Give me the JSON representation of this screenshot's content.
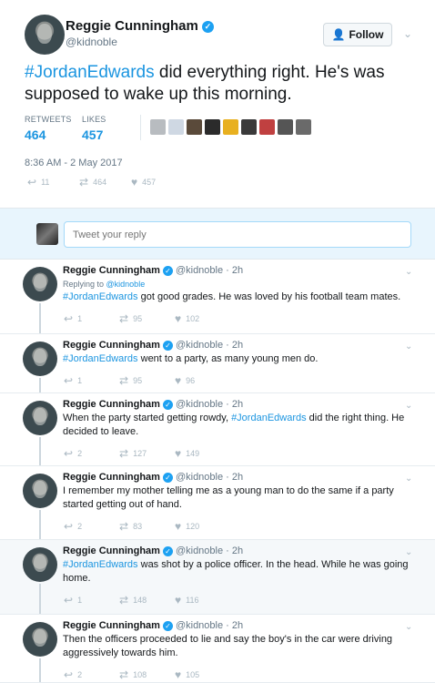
{
  "main": {
    "author_name": "Reggie Cunningham",
    "author_handle": "@kidnoble",
    "follow_label": "Follow",
    "text_hashtag": "#JordanEdwards",
    "text_rest": " did everything right. He's was supposed to wake up this morning.",
    "retweets_label": "RETWEETS",
    "retweets": "464",
    "likes_label": "LIKES",
    "likes": "457",
    "timestamp": "8:36 AM - 2 May 2017",
    "reply_count": "11",
    "retweet_count": "464",
    "like_count": "457"
  },
  "reply_box": {
    "placeholder": "Tweet your reply"
  },
  "replies": [
    {
      "name": "Reggie Cunningham",
      "handle": "@kidnoble · 2h",
      "replying_prefix": "Replying to ",
      "replying_to": "@kidnoble",
      "hashtag": "#JordanEdwards",
      "text": " got good grades. He was loved by his football team mates.",
      "replies": "1",
      "retweets": "95",
      "likes": "102"
    },
    {
      "name": "Reggie Cunningham",
      "handle": "@kidnoble · 2h",
      "hashtag": "#JordanEdwards",
      "text": " went to a party, as many young men do.",
      "replies": "1",
      "retweets": "95",
      "likes": "96"
    },
    {
      "name": "Reggie Cunningham",
      "handle": "@kidnoble · 2h",
      "text_before": "When the party started getting rowdy, ",
      "hashtag": "#JordanEdwards",
      "text": " did the right thing. He decided to leave.",
      "replies": "2",
      "retweets": "127",
      "likes": "149"
    },
    {
      "name": "Reggie Cunningham",
      "handle": "@kidnoble · 2h",
      "text": "I remember my mother telling me as a young man to do the same if a party started getting out of hand.",
      "replies": "2",
      "retweets": "83",
      "likes": "120"
    },
    {
      "name": "Reggie Cunningham",
      "handle": "@kidnoble · 2h",
      "hashtag": "#JordanEdwards",
      "text": "  was shot by a police officer. In the head. While he was going home.",
      "replies": "1",
      "retweets": "148",
      "likes": "116"
    },
    {
      "name": "Reggie Cunningham",
      "handle": "@kidnoble · 2h",
      "text": "Then the officers proceeded to lie and say the boy's in the car were driving aggressively towards him.",
      "replies": "2",
      "retweets": "108",
      "likes": "105"
    }
  ],
  "colors": {
    "link": "#1b95e0",
    "verified": "#1da1f2",
    "muted": "#657786",
    "reply_bg": "#e8f5fd"
  },
  "likers": [
    "#b8bcc0",
    "#cfd8e3",
    "#5a4a3a",
    "#2b2b2b",
    "#e8b020",
    "#3a3a3a",
    "#c04040",
    "#555555",
    "#6a6a6a"
  ]
}
